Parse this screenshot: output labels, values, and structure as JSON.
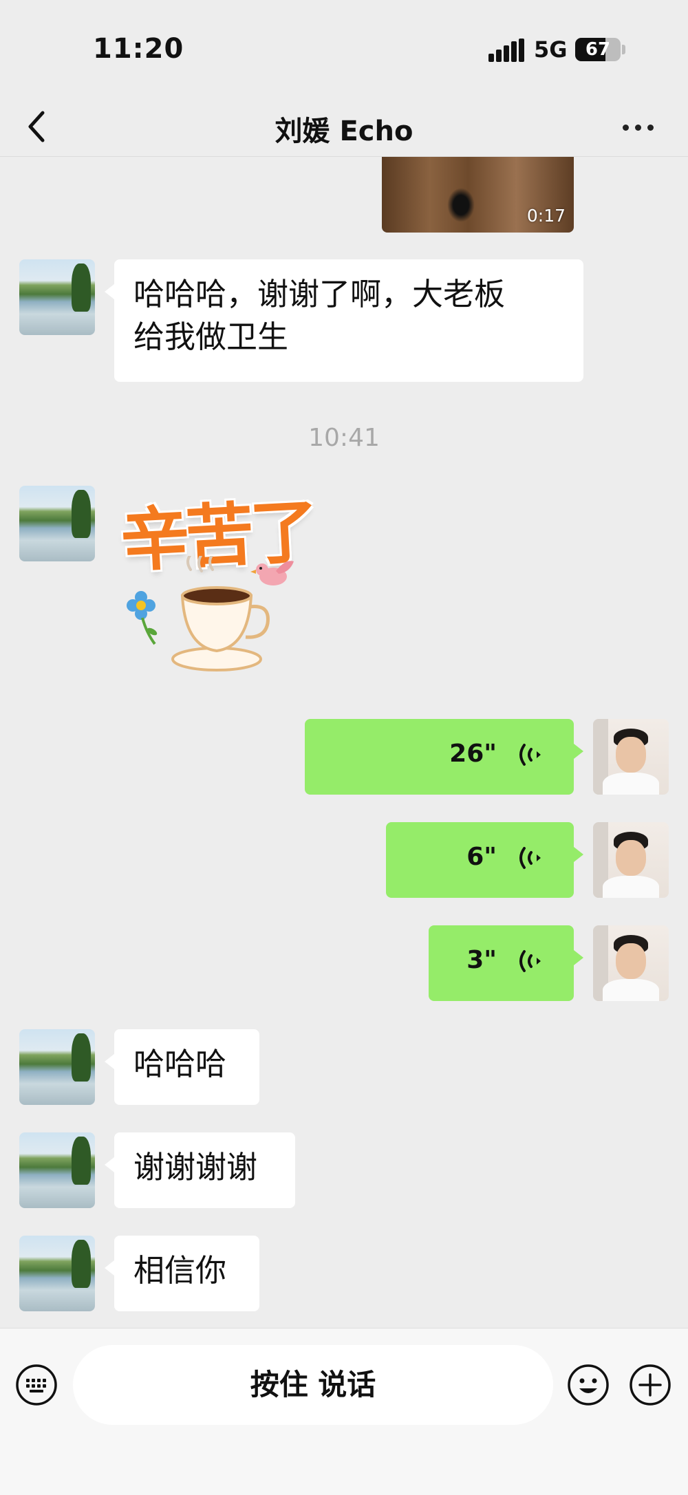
{
  "status_bar": {
    "time": "11:20",
    "network": "5G",
    "battery": "67",
    "battery_level": 0.67
  },
  "header": {
    "title": "刘媛 Echo"
  },
  "messages": {
    "video": {
      "duration": "0:17"
    },
    "m1": {
      "text_line1": "哈哈哈，谢谢了啊，大老板",
      "text_line2": "给我做卫生"
    },
    "time_divider": "10:41",
    "sticker": {
      "text": "辛苦了"
    },
    "voice1": {
      "duration": "26\""
    },
    "voice2": {
      "duration": "6\""
    },
    "voice3": {
      "duration": "3\""
    },
    "m2": {
      "text": "哈哈哈"
    },
    "m3": {
      "text": "谢谢谢谢"
    },
    "m4": {
      "text": "相信你"
    }
  },
  "input_bar": {
    "hold_to_talk": "按住 说话"
  },
  "colors": {
    "background": "#ededed",
    "self_bubble": "#95ec69",
    "peer_bubble": "#ffffff",
    "sticker_orange": "#f47a1f"
  },
  "icons": [
    "back-icon",
    "more-icon",
    "voice-wave-icon",
    "keyboard-voice-icon",
    "emoji-icon",
    "plus-icon"
  ]
}
